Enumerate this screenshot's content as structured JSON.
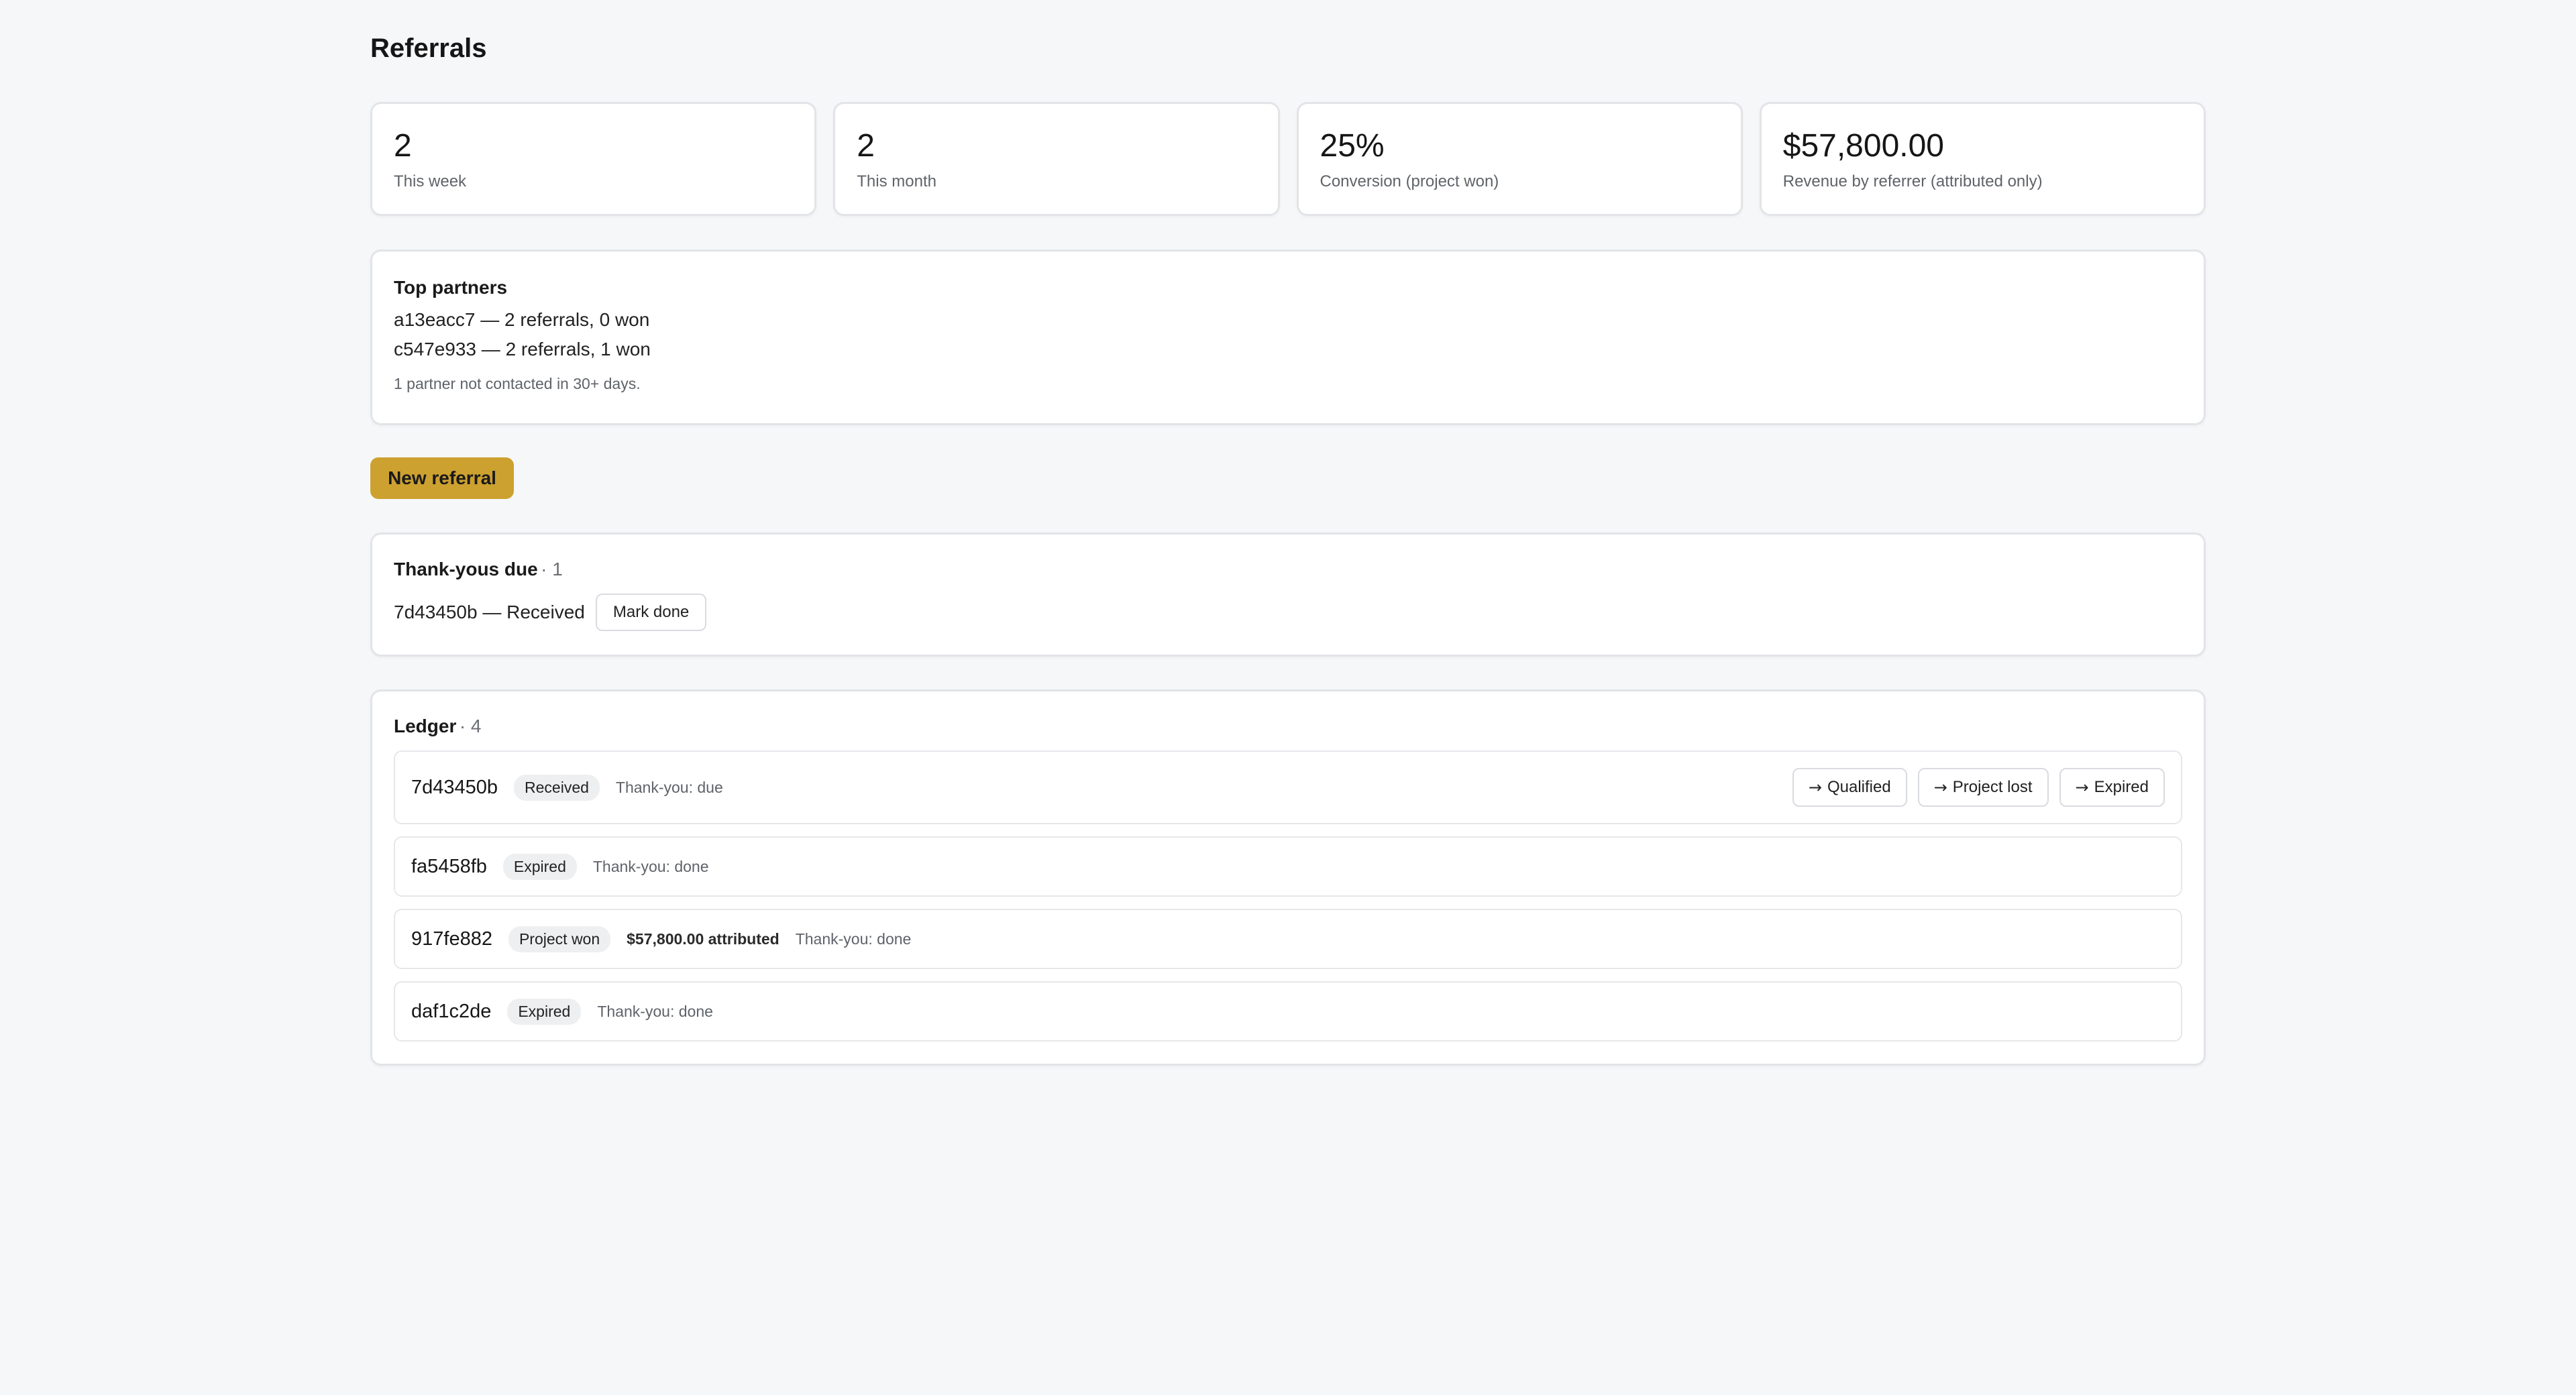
{
  "page": {
    "title": "Referrals"
  },
  "stats": [
    {
      "value": "2",
      "label": "This week"
    },
    {
      "value": "2",
      "label": "This month"
    },
    {
      "value": "25%",
      "label": "Conversion (project won)"
    },
    {
      "value": "$57,800.00",
      "label": "Revenue by referrer (attributed only)"
    }
  ],
  "partners": {
    "title": "Top partners",
    "lines": [
      "a13eacc7 — 2 referrals, 0 won",
      "c547e933 — 2 referrals, 1 won"
    ],
    "note": "1 partner not contacted in 30+ days."
  },
  "actions": {
    "new_referral_label": "New referral"
  },
  "thank_yous": {
    "title": "Thank-yous due",
    "count": "· 1",
    "item": {
      "text": "7d43450b — Received",
      "button_label": "Mark done"
    }
  },
  "ledger": {
    "title": "Ledger",
    "count": "· 4",
    "rows": [
      {
        "id": "7d43450b",
        "status": "Received",
        "thank_you": "Thank-you: due",
        "actions": [
          {
            "label": "Qualified"
          },
          {
            "label": "Project lost"
          },
          {
            "label": "Expired"
          }
        ]
      },
      {
        "id": "fa5458fb",
        "status": "Expired",
        "thank_you": "Thank-you: done"
      },
      {
        "id": "917fe882",
        "status": "Project won",
        "amount": "$57,800.00 attributed",
        "thank_you": "Thank-you: done"
      },
      {
        "id": "daf1c2de",
        "status": "Expired",
        "thank_you": "Thank-you: done"
      }
    ]
  },
  "icons": {
    "transition": "arrow-right-icon"
  },
  "colors": {
    "accent": "#cda12f",
    "background": "#f6f7f9"
  }
}
